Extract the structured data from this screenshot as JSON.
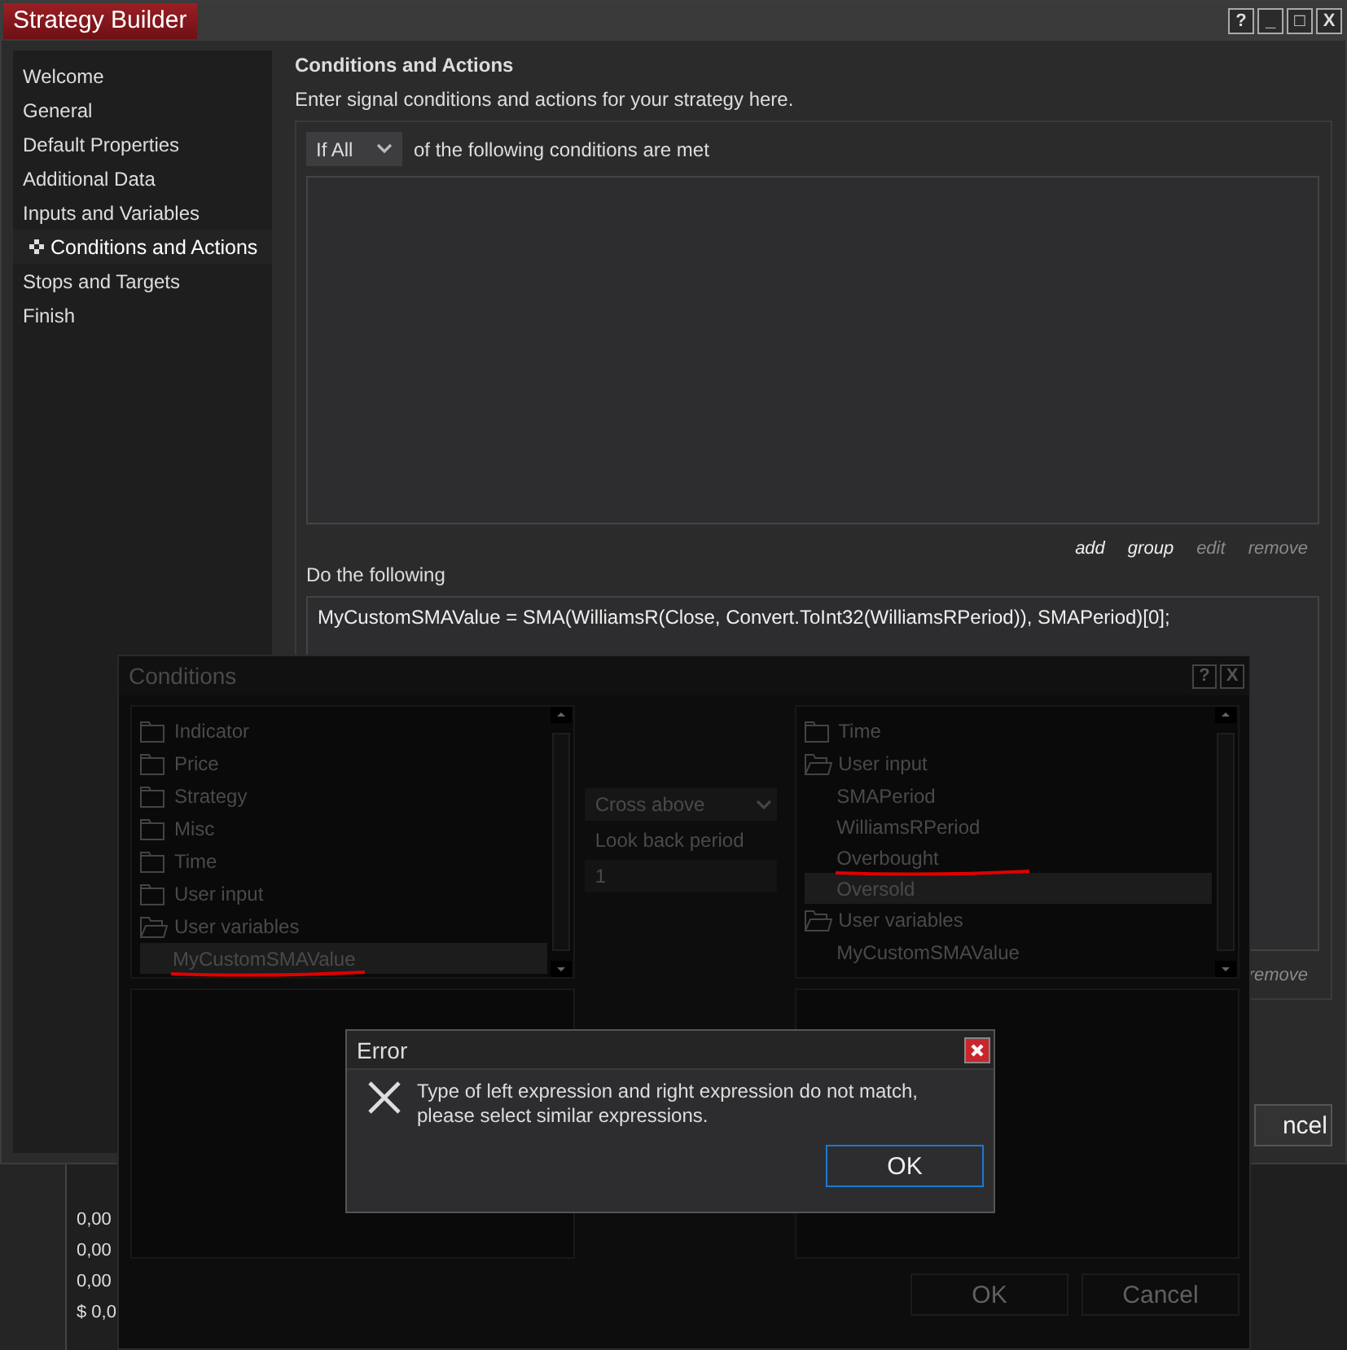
{
  "window": {
    "title": "Strategy Builder",
    "controls": [
      "?",
      "_",
      "□",
      "X"
    ]
  },
  "sidebar": {
    "items": [
      {
        "label": "Welcome",
        "selected": false
      },
      {
        "label": "General",
        "selected": false
      },
      {
        "label": "Default Properties",
        "selected": false
      },
      {
        "label": "Additional Data",
        "selected": false
      },
      {
        "label": "Inputs and Variables",
        "selected": false
      },
      {
        "label": "Conditions and Actions",
        "selected": true
      },
      {
        "label": "Stops and Targets",
        "selected": false
      },
      {
        "label": "Finish",
        "selected": false
      }
    ]
  },
  "page": {
    "heading": "Conditions and Actions",
    "description": "Enter signal conditions and actions for your strategy here.",
    "match_select": {
      "value": "If All"
    },
    "match_text": "of the following conditions are met",
    "condition_links": [
      {
        "label": "add",
        "disabled": false
      },
      {
        "label": "group",
        "disabled": false
      },
      {
        "label": "edit",
        "disabled": true
      },
      {
        "label": "remove",
        "disabled": true
      }
    ],
    "actions_label": "Do the following",
    "actions_code": "MyCustomSMAValue = SMA(WilliamsR(Close, Convert.ToInt32(WilliamsRPeriod)), SMAPeriod)[0];",
    "action_links": [
      {
        "label": "remove",
        "disabled": true
      }
    ],
    "cancel_button": "ncel"
  },
  "background_chart": {
    "labels": [
      "0,00",
      "0,00",
      "0,00",
      "$ 0,0"
    ]
  },
  "conditions_dialog": {
    "title": "Conditions",
    "controls": [
      "?",
      "X"
    ],
    "left_tree": [
      {
        "kind": "folder",
        "label": "Indicator",
        "expanded": false,
        "selected": false
      },
      {
        "kind": "folder",
        "label": "Price",
        "expanded": false,
        "selected": false
      },
      {
        "kind": "folder",
        "label": "Strategy",
        "expanded": false,
        "selected": false
      },
      {
        "kind": "folder",
        "label": "Misc",
        "expanded": false,
        "selected": false
      },
      {
        "kind": "folder",
        "label": "Time",
        "expanded": false,
        "selected": false
      },
      {
        "kind": "folder",
        "label": "User input",
        "expanded": false,
        "selected": false
      },
      {
        "kind": "folder",
        "label": "User variables",
        "expanded": true,
        "selected": false,
        "children": [
          {
            "kind": "item",
            "label": "MyCustomSMAValue",
            "selected": true,
            "underlined": true
          }
        ]
      }
    ],
    "operator": {
      "value": "Cross above"
    },
    "lookback_label": "Look back period",
    "lookback_value": "1",
    "right_tree": [
      {
        "kind": "folder",
        "label": "Time",
        "expanded": false,
        "selected": false
      },
      {
        "kind": "folder",
        "label": "User input",
        "expanded": true,
        "selected": false,
        "children": [
          {
            "kind": "item",
            "label": "SMAPeriod",
            "selected": false,
            "underlined": false
          },
          {
            "kind": "item",
            "label": "WilliamsRPeriod",
            "selected": false,
            "underlined": false
          },
          {
            "kind": "item",
            "label": "Overbought",
            "selected": false,
            "underlined": true
          },
          {
            "kind": "item",
            "label": "Oversold",
            "selected": true,
            "underlined": false
          }
        ]
      },
      {
        "kind": "folder",
        "label": "User variables",
        "expanded": true,
        "selected": false,
        "children": [
          {
            "kind": "item",
            "label": "MyCustomSMAValue",
            "selected": false,
            "underlined": false
          }
        ]
      }
    ],
    "buttons": [
      "OK",
      "Cancel"
    ]
  },
  "error_dialog": {
    "title": "Error",
    "message": "Type of left expression and right expression do not match, please select similar expressions.",
    "button": "OK"
  }
}
